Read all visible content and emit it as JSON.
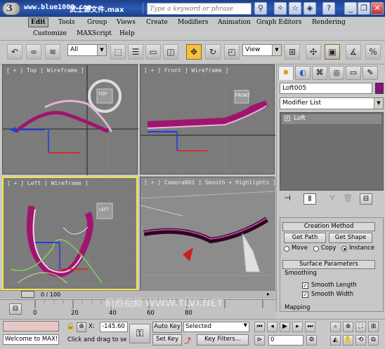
{
  "title": {
    "url": "www.blue1000.com",
    "file": "武士源文件.max",
    "search_placeholder": "Type a keyword or phrase",
    "app_logo": "3"
  },
  "menu": {
    "items": [
      "Edit",
      "Tools",
      "Group",
      "Views",
      "Create",
      "Modifiers",
      "Animation",
      "Graph Editors",
      "Rendering",
      "Customize",
      "MAXScript",
      "Help"
    ]
  },
  "toolbar": {
    "filter_value": "All",
    "coord_value": "View"
  },
  "viewports": {
    "top": "[ + ] Top ] Wireframe ]",
    "front": "[ + ] Front ] Wireframe ]",
    "left": "[ + ] Left ] Wireframe ]",
    "camera": "[ + ] Camera001 ] Smooth + Highlights ]",
    "cube_top": "TOP",
    "cube_front": "FRONT",
    "cube_left": "LEFT"
  },
  "command_panel": {
    "object_name": "Loft005",
    "modifier_list": "Modifier List",
    "stack_item": "Loft",
    "creation_method": "Creation Method",
    "get_path": "Get Path",
    "get_shape": "Get Shape",
    "move": "Move",
    "copy": "Copy",
    "instance": "Instance",
    "surface_parameters": "Surface Parameters",
    "smoothing": "Smoothing",
    "smooth_length": "Smooth Length",
    "smooth_width": "Smooth Width",
    "mapping": "Mapping"
  },
  "timeline": {
    "frame": "0 / 100",
    "ticks": [
      "0",
      "20",
      "40",
      "60",
      "80"
    ],
    "watermark": "隆燕视频 WWW.TLVI.NET"
  },
  "status": {
    "listener": "Welcome to MAX!",
    "prompt": "Click and drag to sele",
    "x_label": "X:",
    "x_value": "-145.60",
    "auto_key": "Auto Key",
    "set_key": "Set Key",
    "key_mode": "Selected",
    "key_filters": "Key Filters...",
    "frame_field": "0"
  },
  "colors": {
    "title_bar": "#2b5bb8",
    "viewport_bg": "#7b7b7b",
    "active_border": "#f3e742",
    "selection": "#8a0f7f",
    "object_color": "#8a0f7f"
  }
}
